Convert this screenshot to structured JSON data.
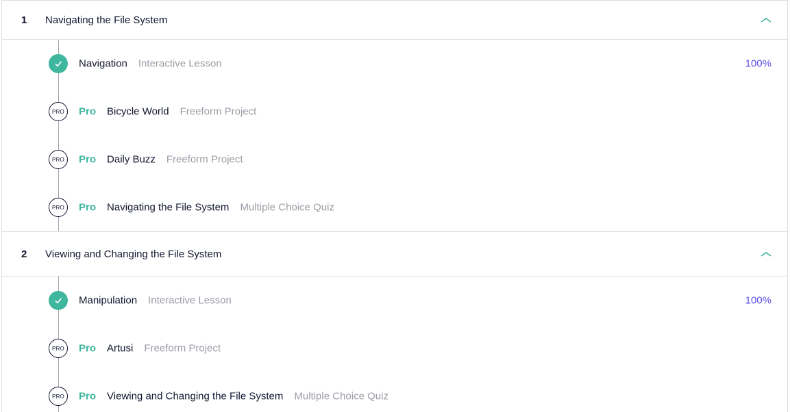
{
  "colors": {
    "accent_green": "#3fb69e",
    "progress_purple": "#5a4ce6",
    "text_dark": "#10162f",
    "text_muted": "#9a9da6"
  },
  "modules": [
    {
      "number": "1",
      "title": "Navigating the File System",
      "expanded": true,
      "chevron_icon": "chevron-up-icon",
      "items": [
        {
          "status": "complete",
          "icon": "check-icon",
          "pro": "",
          "name": "Navigation",
          "type": "Interactive Lesson",
          "progress": "100%"
        },
        {
          "status": "pro",
          "icon": "pro-badge-icon",
          "badge": "PRO",
          "pro": "Pro",
          "name": "Bicycle World",
          "type": "Freeform Project",
          "progress": ""
        },
        {
          "status": "pro",
          "icon": "pro-badge-icon",
          "badge": "PRO",
          "pro": "Pro",
          "name": "Daily Buzz",
          "type": "Freeform Project",
          "progress": ""
        },
        {
          "status": "pro",
          "icon": "pro-badge-icon",
          "badge": "PRO",
          "pro": "Pro",
          "name": "Navigating the File System",
          "type": "Multiple Choice Quiz",
          "progress": ""
        }
      ]
    },
    {
      "number": "2",
      "title": "Viewing and Changing the File System",
      "expanded": true,
      "chevron_icon": "chevron-up-icon",
      "items": [
        {
          "status": "complete",
          "icon": "check-icon",
          "pro": "",
          "name": "Manipulation",
          "type": "Interactive Lesson",
          "progress": "100%"
        },
        {
          "status": "pro",
          "icon": "pro-badge-icon",
          "badge": "PRO",
          "pro": "Pro",
          "name": "Artusi",
          "type": "Freeform Project",
          "progress": ""
        },
        {
          "status": "pro",
          "icon": "pro-badge-icon",
          "badge": "PRO",
          "pro": "Pro",
          "name": "Viewing and Changing the File System",
          "type": "Multiple Choice Quiz",
          "progress": ""
        }
      ]
    }
  ]
}
